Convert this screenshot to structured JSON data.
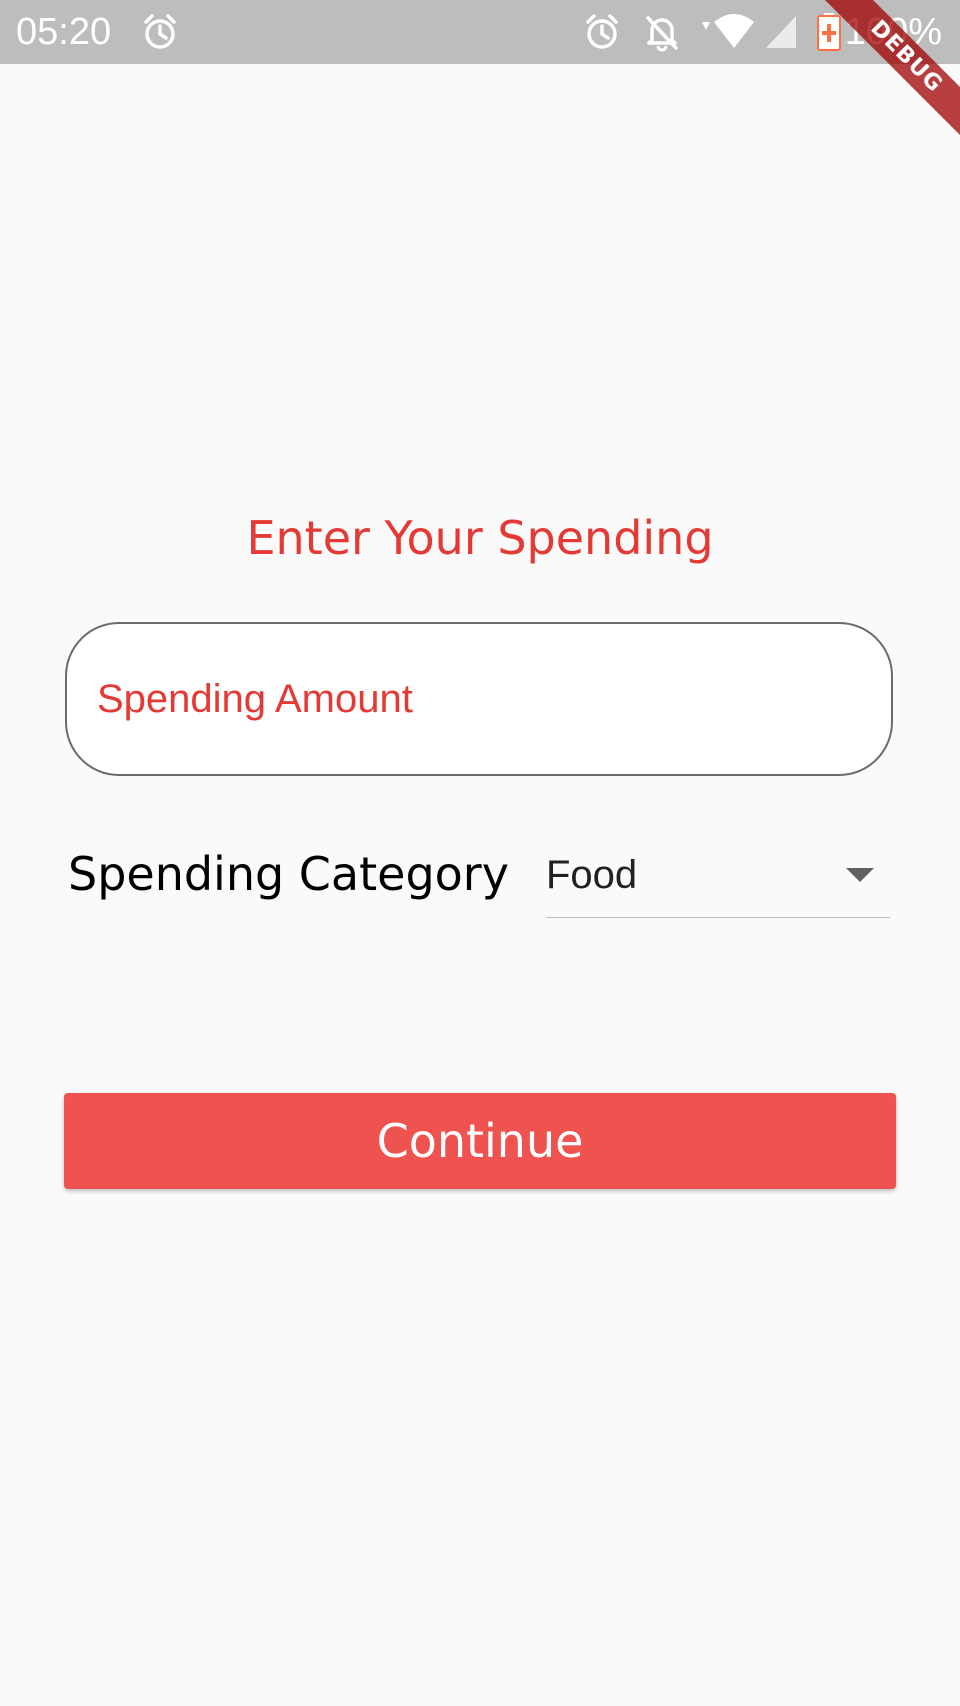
{
  "status_bar": {
    "time": "05:20",
    "battery_text": "100%",
    "icons": [
      "alarm-icon",
      "alarm-icon",
      "notifications-off-icon",
      "wifi-icon",
      "signal-icon",
      "battery-charging-icon"
    ]
  },
  "debug_banner": {
    "label": "DEBUG"
  },
  "form": {
    "title": "Enter Your Spending",
    "amount_placeholder": "Spending Amount",
    "amount_value": "",
    "category_label": "Spending Category",
    "category_selected": "Food",
    "continue_label": "Continue"
  },
  "colors": {
    "accent": "#e53935",
    "button": "#ef5350",
    "status_bar": "#bdbdbd",
    "background": "#fafafa"
  }
}
